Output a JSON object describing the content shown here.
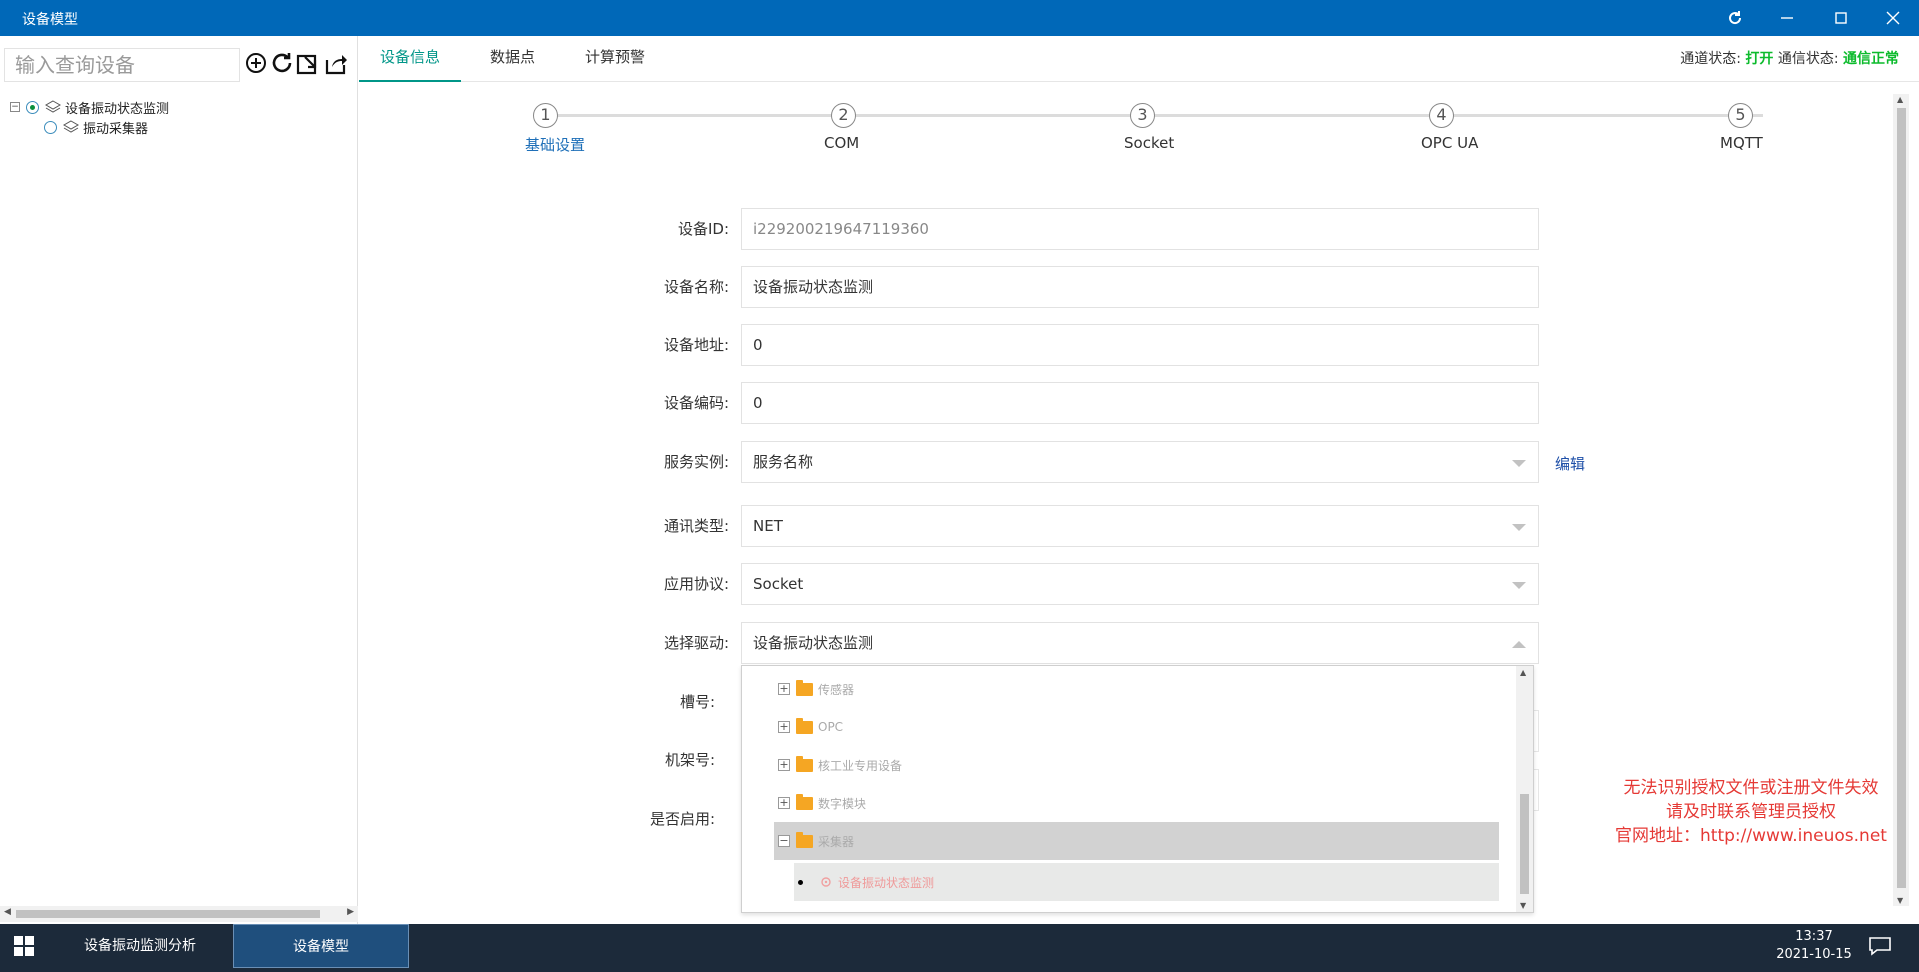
{
  "window": {
    "title": "设备模型"
  },
  "left": {
    "search_placeholder": "输入查询设备",
    "tree": [
      {
        "label": "设备振动状态监测",
        "checked": true
      },
      {
        "label": "振动采集器",
        "checked": false
      }
    ]
  },
  "tabs": [
    {
      "label": "设备信息",
      "active": true
    },
    {
      "label": "数据点",
      "active": false
    },
    {
      "label": "计算预警",
      "active": false
    }
  ],
  "status": {
    "channel_label": "通道状态:",
    "channel_value": "打开",
    "comm_label": "通信状态:",
    "comm_value": "通信正常"
  },
  "steps": [
    {
      "num": "1",
      "label": "基础设置",
      "active": true
    },
    {
      "num": "2",
      "label": "COM",
      "active": false
    },
    {
      "num": "3",
      "label": "Socket",
      "active": false
    },
    {
      "num": "4",
      "label": "OPC UA",
      "active": false
    },
    {
      "num": "5",
      "label": "MQTT",
      "active": false
    }
  ],
  "form": {
    "device_id": {
      "label": "设备ID:",
      "value": "i229200219647119360"
    },
    "device_name": {
      "label": "设备名称:",
      "value": "设备振动状态监测"
    },
    "device_address": {
      "label": "设备地址:",
      "value": "0"
    },
    "device_code": {
      "label": "设备编码:",
      "value": "0"
    },
    "service_instance": {
      "label": "服务实例:",
      "value": "服务名称"
    },
    "comm_type": {
      "label": "通讯类型:",
      "value": "NET"
    },
    "app_protocol": {
      "label": "应用协议:",
      "value": "Socket"
    },
    "driver": {
      "label": "选择驱动:",
      "value": "设备振动状态监测"
    },
    "slot": {
      "label": "槽号:"
    },
    "rack": {
      "label": "机架号:"
    },
    "enabled": {
      "label": "是否启用:"
    },
    "edit_label": "编辑"
  },
  "driver_tree": {
    "nodes": [
      {
        "label": "传感器",
        "expanded": false
      },
      {
        "label": "OPC",
        "expanded": false
      },
      {
        "label": "核工业专用设备",
        "expanded": false
      },
      {
        "label": "数字模块",
        "expanded": false
      },
      {
        "label": "采集器",
        "expanded": true
      }
    ],
    "leaf": "设备振动状态监测"
  },
  "watermark": {
    "line1": "无法识别授权文件或注册文件失效",
    "line2": "请及时联系管理员授权",
    "line3": "官网地址：http://www.ineuos.net"
  },
  "taskbar": {
    "tasks": [
      {
        "label": "设备振动监测分析",
        "active": false
      },
      {
        "label": "设备模型",
        "active": true
      }
    ],
    "time": "13:37",
    "date": "2021-10-15"
  },
  "colors": {
    "titlebar": "#0068b8",
    "tab_active": "#009688",
    "status_ok": "#0dbb2d",
    "watermark": "#e53935",
    "taskbar": "#1c2a3a"
  }
}
